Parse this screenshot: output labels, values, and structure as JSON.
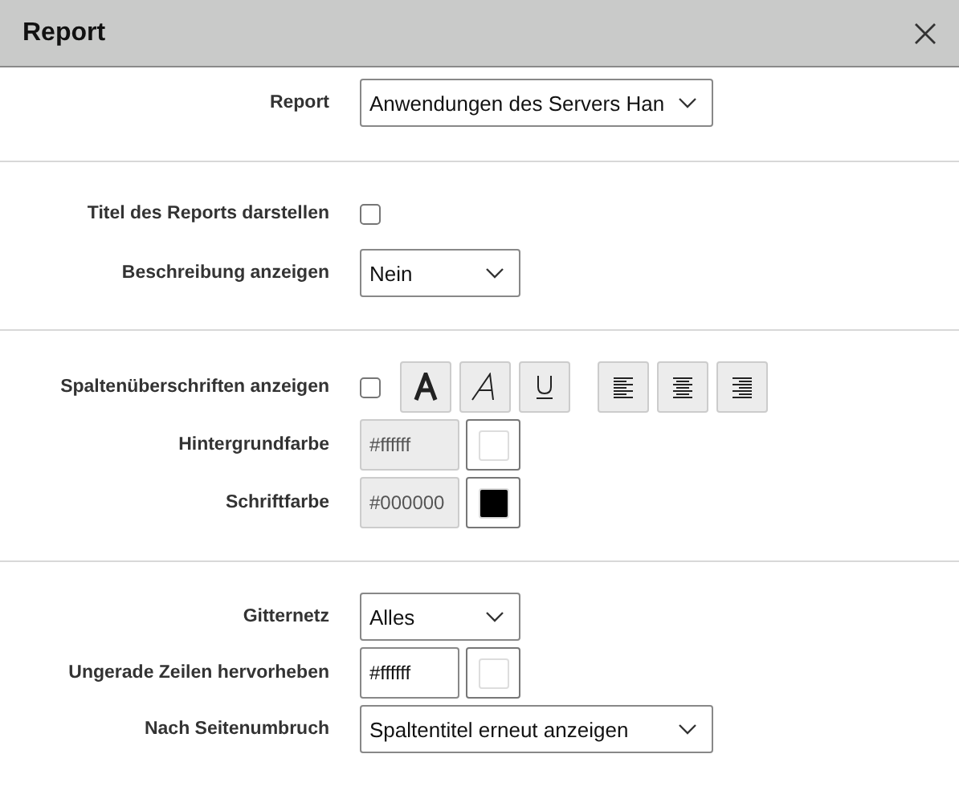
{
  "window": {
    "title": "Report"
  },
  "sections": [
    {
      "rows": [
        {
          "kind": "wide_select",
          "label": "Report",
          "value": "Anwendungen des Servers Han"
        }
      ]
    },
    {
      "rows": [
        {
          "kind": "checkbox",
          "label": "Titel des Reports darstellen",
          "checked": false
        },
        {
          "kind": "narrow_select",
          "label": "Beschreibung anzeigen",
          "value": "Nein"
        }
      ]
    },
    {
      "rows": [
        {
          "kind": "heading",
          "label": "Spaltenüberschriften anzeigen",
          "checked": false,
          "format_buttons": [
            {
              "kind": "bold"
            },
            {
              "kind": "italic"
            },
            {
              "kind": "underline"
            }
          ],
          "align_buttons": [
            {
              "kind": "left"
            },
            {
              "kind": "center"
            },
            {
              "kind": "right"
            }
          ]
        },
        {
          "kind": "color",
          "label": "Hintergrundfarbe",
          "value": "#ffffff",
          "color": "#ffffff",
          "disabled": true
        },
        {
          "kind": "color",
          "label": "Schriftfarbe",
          "value": "#000000",
          "color": "#000000",
          "disabled": true
        }
      ]
    },
    {
      "rows": [
        {
          "kind": "narrow_select",
          "label": "Gitternetz",
          "value": "Alles"
        },
        {
          "kind": "color",
          "label": "Ungerade Zeilen hervorheben",
          "value": "#ffffff",
          "color": "#ffffff",
          "disabled": false
        },
        {
          "kind": "wide_select",
          "label": "Nach Seitenumbruch",
          "value": "Spaltentitel erneut anzeigen"
        }
      ]
    }
  ]
}
